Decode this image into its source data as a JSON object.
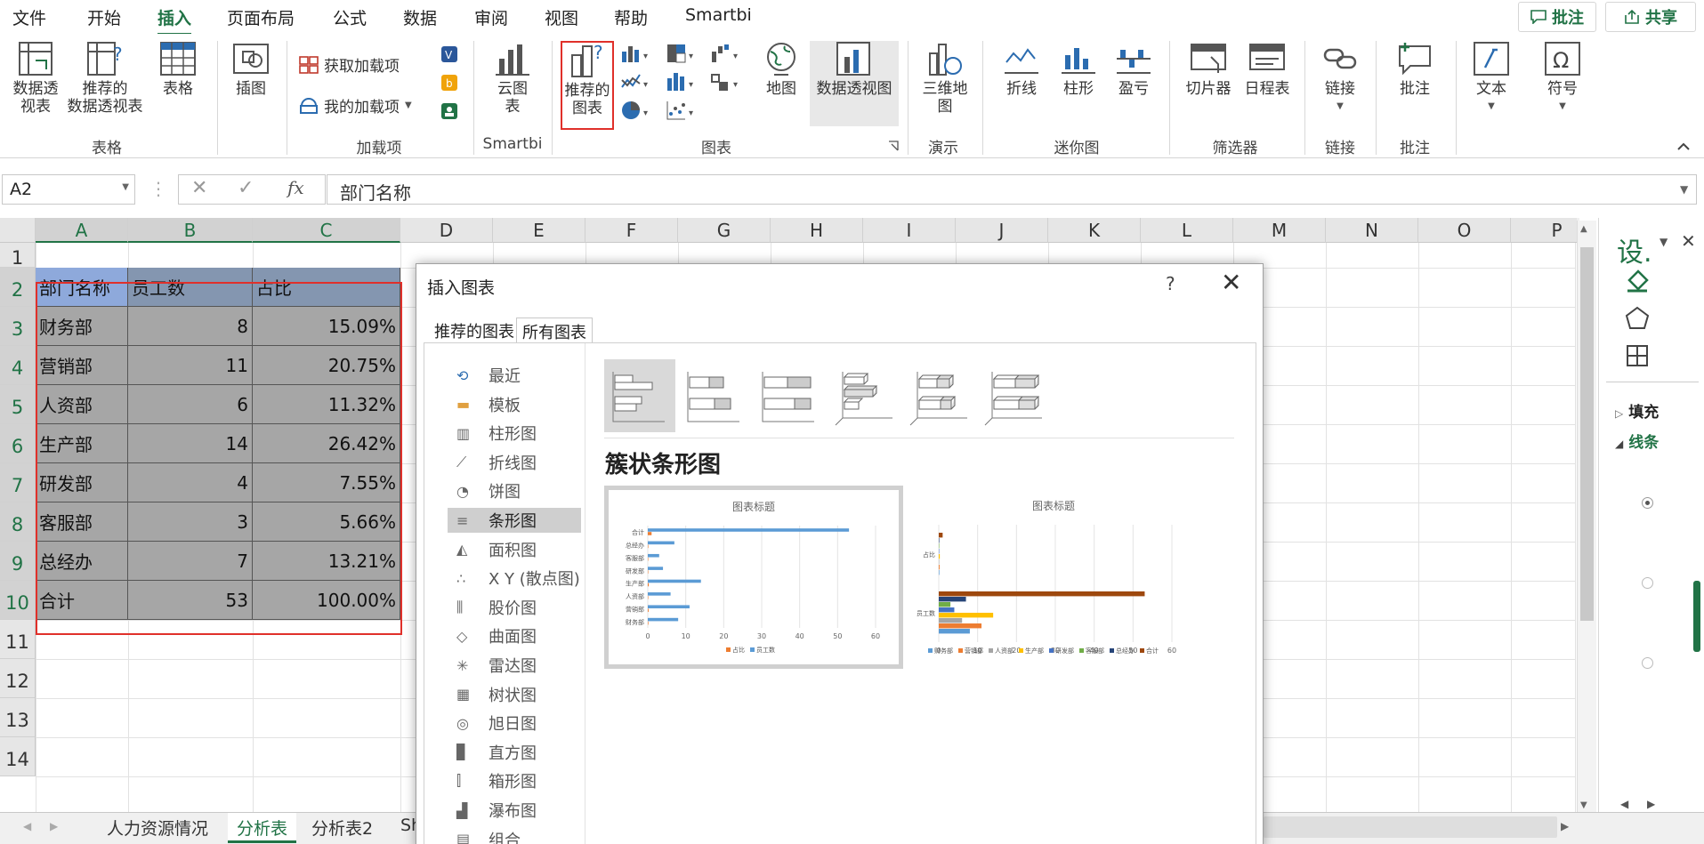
{
  "menu": {
    "items": [
      "文件",
      "开始",
      "插入",
      "页面布局",
      "公式",
      "数据",
      "审阅",
      "视图",
      "帮助",
      "Smartbi"
    ],
    "active": "插入",
    "comment_btn": "批注",
    "share_btn": "共享"
  },
  "ribbon": {
    "pivot": "数据透\n视表",
    "rec_pivot": "推荐的\n数据透视表",
    "table": "表格",
    "group_table": "表格",
    "illus": "插图",
    "get_addins": "获取加载项",
    "my_addins": "我的加载项",
    "group_addins": "加载项",
    "cloud": "云图\n表",
    "group_smartbi": "Smartbi",
    "rec_charts": "推荐的\n图表",
    "map": "地图",
    "pivot_chart": "数据透视图",
    "group_charts": "图表",
    "map3d": "三维地\n图",
    "group_tour": "演示",
    "line": "折线",
    "column": "柱形",
    "winloss": "盈亏",
    "group_spark": "迷你图",
    "slicer": "切片器",
    "timeline": "日程表",
    "group_filter": "筛选器",
    "link": "链接",
    "group_link": "链接",
    "comment": "批注",
    "group_comment": "批注",
    "text": "文本",
    "symbol": "符号"
  },
  "formula_bar": {
    "name_box": "A2",
    "fx": "fx",
    "value": "部门名称"
  },
  "sheet": {
    "columns": [
      "A",
      "B",
      "C",
      "D",
      "E",
      "F",
      "G",
      "H",
      "I",
      "J",
      "K",
      "L",
      "M",
      "N",
      "O",
      "P"
    ],
    "rows": [
      "1",
      "2",
      "3",
      "4",
      "5",
      "6",
      "7",
      "8",
      "9",
      "10",
      "11",
      "12",
      "13",
      "14"
    ],
    "table": [
      [
        "部门名称",
        "员工数",
        "占比"
      ],
      [
        "财务部",
        "8",
        "15.09%"
      ],
      [
        "营销部",
        "11",
        "20.75%"
      ],
      [
        "人资部",
        "6",
        "11.32%"
      ],
      [
        "生产部",
        "14",
        "26.42%"
      ],
      [
        "研发部",
        "4",
        "7.55%"
      ],
      [
        "客服部",
        "3",
        "5.66%"
      ],
      [
        "总经办",
        "7",
        "13.21%"
      ],
      [
        "合计",
        "53",
        "100.00%"
      ]
    ]
  },
  "tabs": [
    "人力资源情况",
    "分析表",
    "分析表2",
    "Sh"
  ],
  "active_tab": "分析表",
  "side_pane": {
    "title": "设.",
    "fill": "填充",
    "line": "线条"
  },
  "dialog": {
    "title": "插入图表",
    "help": "?",
    "close": "✕",
    "tabs": [
      "推荐的图表",
      "所有图表"
    ],
    "active_tab": "所有图表",
    "chart_types": [
      "最近",
      "模板",
      "柱形图",
      "折线图",
      "饼图",
      "条形图",
      "面积图",
      "X Y (散点图)",
      "股价图",
      "曲面图",
      "雷达图",
      "树状图",
      "旭日图",
      "直方图",
      "箱形图",
      "瀑布图",
      "组合"
    ],
    "selected_type": "条形图",
    "subtype_title": "簇状条形图",
    "preview1_title": "图表标题",
    "preview2_title": "图表标题"
  },
  "chart_data": [
    {
      "type": "bar",
      "title": "图表标题",
      "categories": [
        "财务部",
        "营销部",
        "人资部",
        "生产部",
        "研发部",
        "客服部",
        "总经办",
        "合计"
      ],
      "series": [
        {
          "name": "员工数",
          "values": [
            8,
            11,
            6,
            14,
            4,
            3,
            7,
            53
          ],
          "color": "#5b9bd5"
        },
        {
          "name": "占比",
          "values": [
            0.1509,
            0.2075,
            0.1132,
            0.2642,
            0.0755,
            0.0566,
            0.1321,
            1
          ],
          "color": "#ed7d31"
        }
      ],
      "xlim": [
        0,
        60
      ],
      "xticks": [
        0,
        10,
        20,
        30,
        40,
        50,
        60
      ]
    },
    {
      "type": "bar",
      "title": "图表标题",
      "categories": [
        "员工数",
        "占比"
      ],
      "series": [
        {
          "name": "合计",
          "values": [
            53,
            1
          ],
          "color": "#9e480e"
        },
        {
          "name": "总经办",
          "values": [
            7,
            0.1321
          ],
          "color": "#264478"
        },
        {
          "name": "客服部",
          "values": [
            3,
            0.0566
          ],
          "color": "#70ad47"
        },
        {
          "name": "研发部",
          "values": [
            4,
            0.0755
          ],
          "color": "#4472c4"
        },
        {
          "name": "生产部",
          "values": [
            14,
            0.2642
          ],
          "color": "#ffc000"
        },
        {
          "name": "人资部",
          "values": [
            6,
            0.1132
          ],
          "color": "#a5a5a5"
        },
        {
          "name": "营销部",
          "values": [
            11,
            0.2075
          ],
          "color": "#ed7d31"
        },
        {
          "name": "财务部",
          "values": [
            8,
            0.1509
          ],
          "color": "#5b9bd5"
        }
      ],
      "xlim": [
        0,
        60
      ],
      "xticks": [
        0,
        10,
        20,
        30,
        40,
        50,
        60
      ]
    }
  ]
}
